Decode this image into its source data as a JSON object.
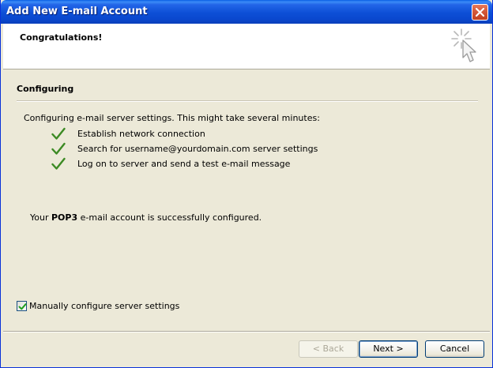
{
  "window": {
    "title": "Add New E-mail Account"
  },
  "header": {
    "title": "Congratulations!"
  },
  "section": {
    "title": "Configuring"
  },
  "intro": "Configuring e-mail server settings. This might take several minutes:",
  "steps": [
    {
      "label": "Establish network connection",
      "status": "done"
    },
    {
      "label": "Search for username@yourdomain.com server settings",
      "status": "done"
    },
    {
      "label": "Log on to server and send a test e-mail message",
      "status": "done"
    }
  ],
  "result": {
    "prefix": "Your ",
    "account_type": "POP3",
    "suffix": " e-mail account is successfully configured."
  },
  "manual_config": {
    "label": "Manually configure server settings",
    "checked": true
  },
  "buttons": {
    "back": "< Back",
    "next": "Next >",
    "cancel": "Cancel"
  },
  "colors": {
    "titlebar": "#0a48cf",
    "face": "#ece9d8",
    "check": "#3c8a23"
  },
  "icons": {
    "close": "close-icon",
    "wizard": "wizard-cursor-icon",
    "step": "checkmark-icon"
  }
}
